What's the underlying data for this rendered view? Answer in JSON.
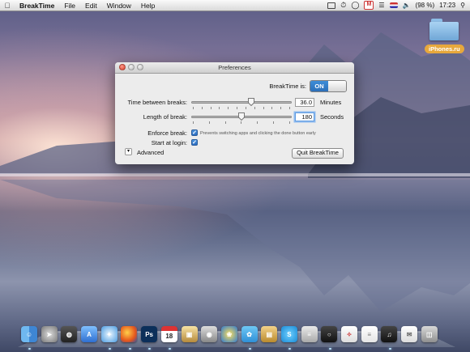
{
  "menubar": {
    "app_name": "BreakTime",
    "menus": [
      "File",
      "Edit",
      "Window",
      "Help"
    ],
    "battery": "(98 %)",
    "clock": "17:23"
  },
  "desktop": {
    "folder_label": "iPhones.ru"
  },
  "window": {
    "title": "Preferences",
    "enabled_label": "BreakTime is:",
    "toggle_state": "ON",
    "time_between_label": "Time between breaks:",
    "time_between_value": "36.0",
    "time_between_unit": "Minutes",
    "time_between_level": 0.6,
    "length_label": "Length of break:",
    "length_value": "180",
    "length_unit": "Seconds",
    "length_level": 0.5,
    "enforce_label": "Enforce break:",
    "enforce_note": "Prevents switching apps and clicking the done button early",
    "login_label": "Start at login:",
    "advanced_label": "Advanced",
    "quit_label": "Quit BreakTime"
  },
  "dock": {
    "items": [
      "finder-icon",
      "rocket-icon",
      "dashboard-icon",
      "app-store-icon",
      "safari-icon",
      "firefox-icon",
      "photoshop-icon",
      "calendar-icon",
      "preview-icon",
      "image-capture-icon",
      "pinwheel-icon",
      "twitter-icon",
      "stack-icon",
      "skype-icon",
      "calculator-icon",
      "silverlock-icon",
      "spread-icon",
      "documents-icon",
      "itunes-icon",
      "mail-draft-icon",
      "trash-icon"
    ]
  },
  "colors": {
    "accent": "#2f73c2",
    "label_bg": "#e7a83c"
  }
}
